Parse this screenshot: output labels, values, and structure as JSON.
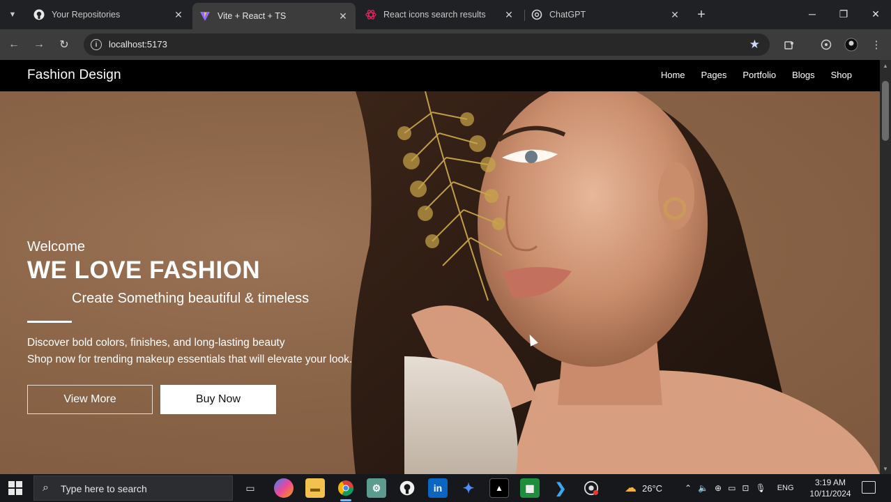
{
  "browser": {
    "tabs": [
      {
        "title": "Your Repositories",
        "icon": "github-icon",
        "active": false
      },
      {
        "title": "Vite + React + TS",
        "icon": "vite-icon",
        "active": true
      },
      {
        "title": "React icons search results",
        "icon": "react-icons-icon",
        "active": false
      },
      {
        "title": "ChatGPT",
        "icon": "chatgpt-icon",
        "active": false
      }
    ],
    "new_tab_label": "+",
    "address": "localhost:5173"
  },
  "site": {
    "brand": "Fashion Design",
    "nav": [
      "Home",
      "Pages",
      "Portfolio",
      "Blogs",
      "Shop"
    ],
    "hero": {
      "welcome": "Welcome",
      "headline": "WE LOVE FASHION",
      "subline": "Create Something beautiful & timeless",
      "description": [
        "Discover bold colors, finishes, and long-lasting beauty",
        "Shop now for trending makeup essentials that will elevate your look."
      ],
      "primary_button": "View More",
      "secondary_button": "Buy Now"
    }
  },
  "taskbar": {
    "search_placeholder": "Type here to search",
    "weather": "26°C",
    "language": "ENG",
    "time": "3:19 AM",
    "date": "10/11/2024"
  },
  "colors": {
    "hero_background": "#8a6447",
    "nav_background": "#000000",
    "taskbar_background": "#16181c"
  }
}
